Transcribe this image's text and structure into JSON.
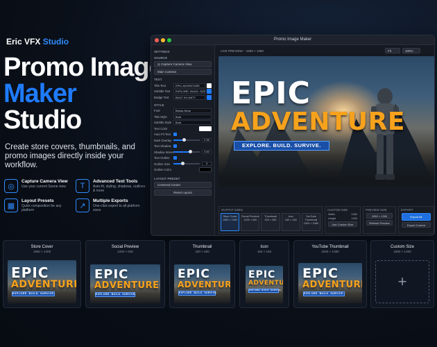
{
  "brand": {
    "name": "Eric VFX",
    "accent": "Studio"
  },
  "hero": {
    "line1": "Promo Image",
    "line2": "Maker",
    "line3": "Studio"
  },
  "lead": "Create store covers, thumbnails, and promo images directly inside your workflow.",
  "features": [
    {
      "icon": "camera-icon",
      "glyph": "◎",
      "title": "Capture Camera View",
      "desc": "Use your current Scene view"
    },
    {
      "icon": "text-icon",
      "glyph": "T",
      "title": "Advanced Text Tools",
      "desc": "Auto-fit, styling, shadows, outlines & more"
    },
    {
      "icon": "layout-icon",
      "glyph": "▦",
      "title": "Layout Presets",
      "desc": "Quick composition for any platform"
    },
    {
      "icon": "export-icon",
      "glyph": "↗",
      "title": "Multiple Exports",
      "desc": "One-click export to all platform sizes"
    }
  ],
  "window": {
    "title": "Promo Image Maker"
  },
  "sidebar": {
    "settings": "SETTINGS",
    "source": "SOURCE",
    "capture": "Capture Camera View",
    "camera": "Main Camera",
    "text": "TEXT",
    "title_label": "Title Text",
    "title_value": "EPIC ADVENTURE",
    "subtitle_label": "Subtitle Text",
    "subtitle_value": "EXPLORE. BUILD. SURVIVE.",
    "badge_label": "Badge Text",
    "badge_value": "BUILT IN UNITY",
    "style": "STYLE",
    "font_label": "Font",
    "font_value": "Bebas Neue",
    "title_style_label": "Title Style",
    "title_style_value": "Bold",
    "subtitle_style_label": "Subtitle Style",
    "subtitle_style_value": "Bold",
    "text_color_label": "Text Color",
    "autofit_label": "Auto Fit Text",
    "dark_overlay_label": "Dark Overlay",
    "dark_overlay_value": "0.35",
    "text_shadow_label": "Text Shadow",
    "shadow_intensity_label": "Shadow Intensity",
    "shadow_intensity_value": "0.60",
    "text_outline_label": "Text Outline",
    "outline_size_label": "Outline Size",
    "outline_size_value": "3",
    "outline_color_label": "Outline Color",
    "layout_preset": "LAYOUT PRESET",
    "layout_value": "Centered Center",
    "reset": "Reset Layout"
  },
  "preview": {
    "label": "LIVE PREVIEW – 1950 × 1300",
    "zoom_a": "Fit",
    "zoom_b": "100%",
    "title1": "EPIC",
    "title2": "ADVENTURE",
    "banner": "EXPLORE. BUILD. SURVIVE."
  },
  "output": {
    "label": "OUTPUT SIZES",
    "chips": [
      {
        "t": "Store Cover",
        "s": "1950 × 1300"
      },
      {
        "t": "Social Preview",
        "s": "1200 × 630"
      },
      {
        "t": "Thumbnail",
        "s": "420 × 280"
      },
      {
        "t": "Icon",
        "s": "160 × 160"
      },
      {
        "t": "YouTube Thumbnail",
        "s": "1920 × 1080"
      }
    ]
  },
  "custom": {
    "label": "CUSTOM SIZE",
    "width_label": "Width",
    "width_value": "1950",
    "height_label": "Height",
    "height_value": "1300",
    "use": "Use Custom Size"
  },
  "preview_size": {
    "label": "PREVIEW SIZE",
    "value": "1950 × 1300",
    "refresh": "Refresh Preview"
  },
  "export": {
    "label": "EXPORT",
    "all": "Export All",
    "current": "Export Current"
  },
  "cards": [
    {
      "t": "Store Cover",
      "s": "1950 × 1300"
    },
    {
      "t": "Social Preview",
      "s": "1200 × 630"
    },
    {
      "t": "Thumbnail",
      "s": "420 × 280"
    },
    {
      "t": "Icon",
      "s": "160 × 160"
    },
    {
      "t": "YouTube Thumbnail",
      "s": "1920 × 1080"
    },
    {
      "t": "Custom Size",
      "s": "1950 × 1300"
    }
  ],
  "colors": {
    "accent": "#1f7cff",
    "orange": "#f7a21c",
    "bg": "#0a0f18"
  }
}
